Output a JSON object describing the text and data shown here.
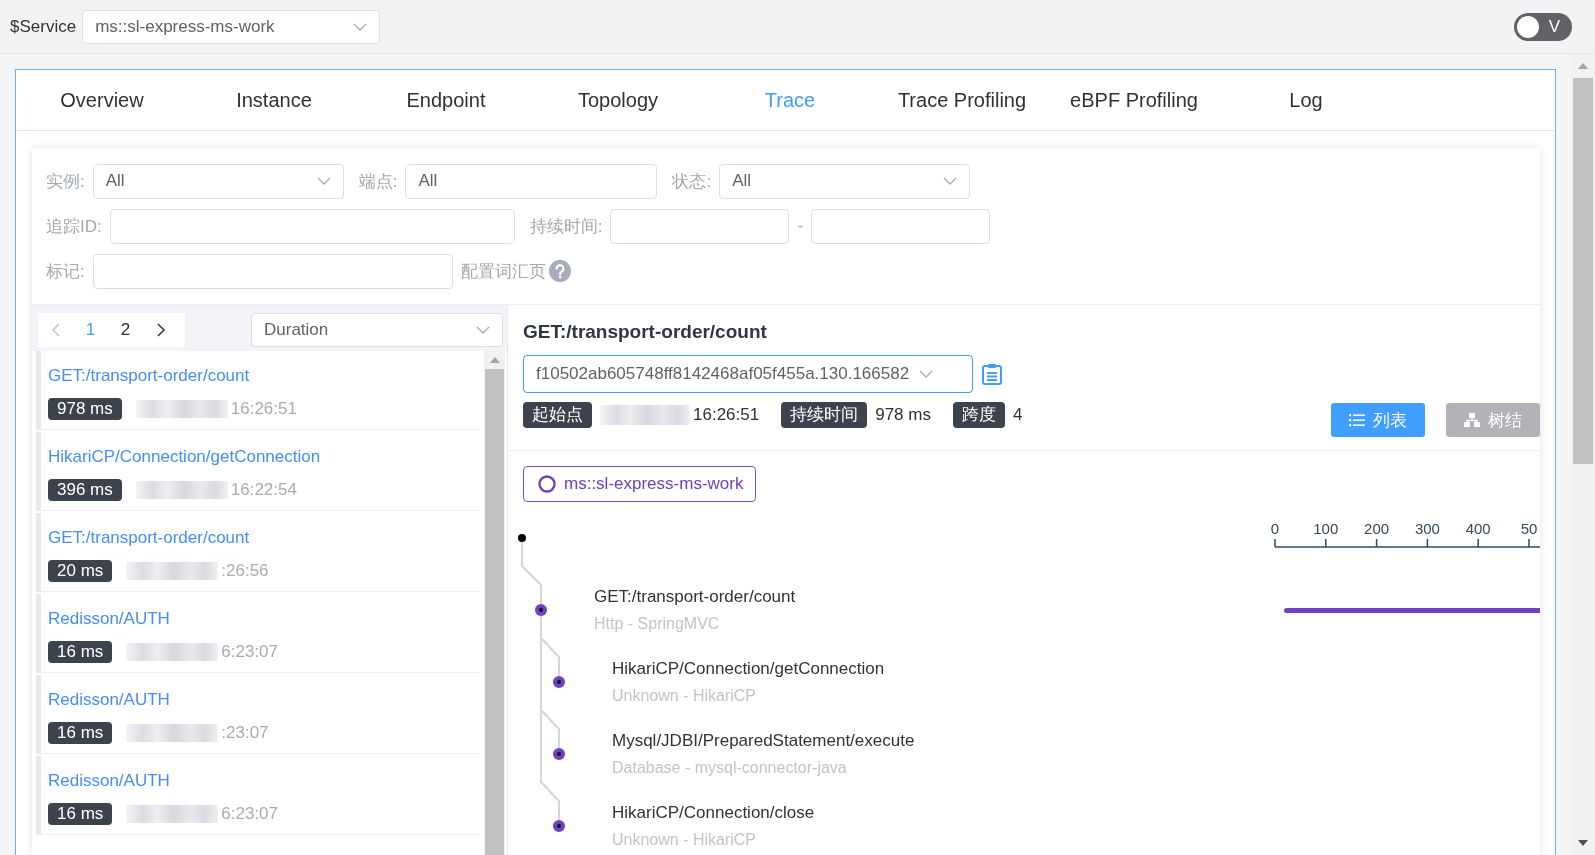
{
  "top_bar": {
    "service_label": "$Service",
    "service": "ms::sl-express-ms-work",
    "toggle": {
      "label": "V",
      "on": false
    }
  },
  "tabs": [
    {
      "label": "Overview",
      "selected": false
    },
    {
      "label": "Instance",
      "selected": false
    },
    {
      "label": "Endpoint",
      "selected": false
    },
    {
      "label": "Topology",
      "selected": false
    },
    {
      "label": "Trace",
      "selected": true
    },
    {
      "label": "Trace Profiling",
      "selected": false
    },
    {
      "label": "eBPF Profiling",
      "selected": false
    },
    {
      "label": "Log",
      "selected": false
    }
  ],
  "filters": {
    "instance": {
      "label": "实例:",
      "value": "All"
    },
    "endpoint": {
      "label": "端点:",
      "value": "All"
    },
    "status": {
      "label": "状态:",
      "value": "All"
    },
    "trace_id": {
      "label": "追踪ID:"
    },
    "duration": {
      "label": "持续时间:",
      "separator": "-"
    },
    "tags": {
      "label": "标记:",
      "help_link": "配置词汇页"
    }
  },
  "trace_list": {
    "pagination": {
      "prev": {
        "disabled": true
      },
      "next": {
        "disabled": false
      },
      "pages": [
        {
          "label": "1",
          "selected": true
        },
        {
          "label": "2",
          "selected": false
        }
      ]
    },
    "sort": "Duration",
    "traces": [
      {
        "endpoint": "GET:/transport-order/count",
        "duration": "978 ms",
        "redacted": true,
        "time": "16:26:51"
      },
      {
        "endpoint": "HikariCP/Connection/getConnection",
        "duration": "396 ms",
        "redacted": true,
        "time": "16:22:54"
      },
      {
        "endpoint": "GET:/transport-order/count",
        "duration": "20 ms",
        "redacted": true,
        "time": ":26:56"
      },
      {
        "endpoint": "Redisson/AUTH",
        "duration": "16 ms",
        "redacted": true,
        "time": "6:23:07"
      },
      {
        "endpoint": "Redisson/AUTH",
        "duration": "16 ms",
        "redacted": true,
        "time": ":23:07"
      },
      {
        "endpoint": "Redisson/AUTH",
        "duration": "16 ms",
        "redacted": true,
        "time": "6:23:07"
      }
    ]
  },
  "trace_detail": {
    "title": "GET:/transport-order/count",
    "trace_id": "f10502ab605748ff8142468af05f455a.130.166582",
    "meta": [
      {
        "label": "起始点",
        "value": "16:26:51",
        "redacted": true
      },
      {
        "label": "持续时间",
        "value": "978 ms",
        "redacted": false
      },
      {
        "label": "跨度",
        "value": "4",
        "redacted": false
      }
    ],
    "view_buttons": [
      {
        "label": "列表",
        "kind": "list",
        "selected": true
      },
      {
        "label": "树结",
        "kind": "tree",
        "selected": false
      }
    ],
    "service_tag": "ms::sl-express-ms-work",
    "axis_ticks": [
      "0",
      "100",
      "200",
      "300",
      "400",
      "50"
    ],
    "spans": [
      {
        "endpoint": "GET:/transport-order/count",
        "component": "Http - SpringMVC",
        "timeline_bar": true,
        "children": [
          {
            "endpoint": "HikariCP/Connection/getConnection",
            "component": "Unknown - HikariCP",
            "timeline_bar": false
          },
          {
            "endpoint": "Mysql/JDBI/PreparedStatement/execute",
            "component": "Database - mysql-connector-java",
            "timeline_bar": false
          },
          {
            "endpoint": "HikariCP/Connection/close",
            "component": "Unknown - HikariCP",
            "timeline_bar": false
          }
        ]
      }
    ]
  }
}
